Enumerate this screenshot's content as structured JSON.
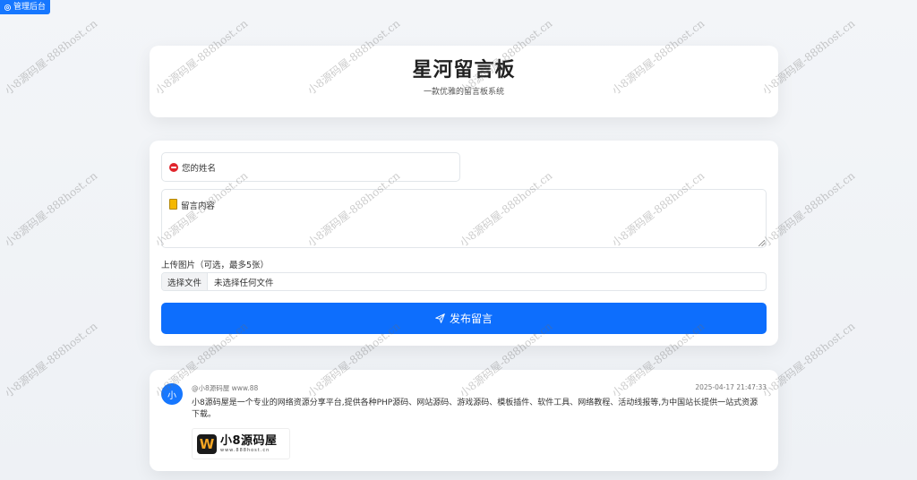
{
  "admin": {
    "label": "管理后台",
    "icon": "gear-icon"
  },
  "header": {
    "title": "星河留言板",
    "subtitle": "一款优雅的留言板系统"
  },
  "form": {
    "name_placeholder": "您的姓名",
    "content_placeholder": "留言内容",
    "upload_label": "上传图片（可选，最多5张）",
    "file_button": "选择文件",
    "file_status": "未选择任何文件",
    "submit_label": "发布留言",
    "submit_icon": "send-icon",
    "accent": "#0d6efd"
  },
  "messages": [
    {
      "avatar_letter": "小",
      "user": "@小8源码屋 www.88",
      "time": "2025-04-17 21:47:33",
      "text": "小8源码屋是一个专业的网络资源分享平台,提供各种PHP源码、网站源码、游戏源码、模板插件、软件工具、网络教程、活动线报等,为中国站长提供一站式资源下载。",
      "image": {
        "mark": "W",
        "title": "小8源码屋",
        "domain": "www.888host.cn"
      }
    }
  ],
  "watermark": {
    "text": "小8源码屋-888host.cn"
  }
}
